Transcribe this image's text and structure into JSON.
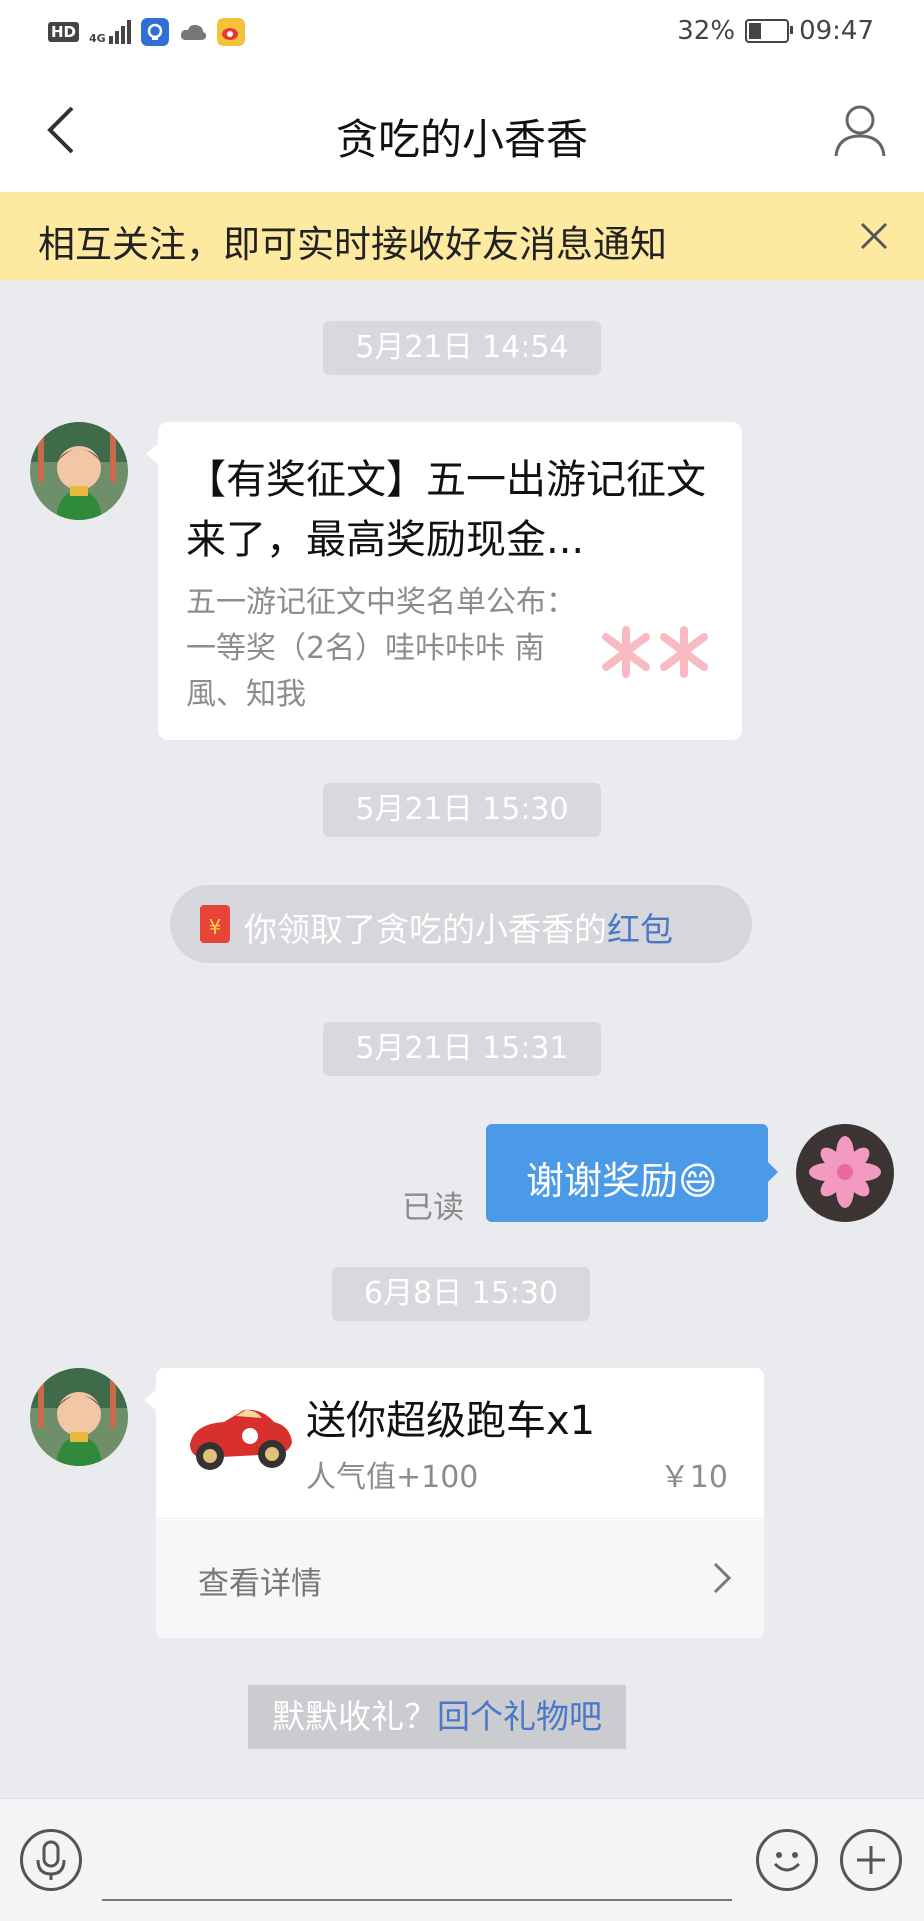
{
  "status_bar": {
    "hd": "HD",
    "network": "4G",
    "battery_percent": "32%",
    "battery_level": 0.32,
    "time": "09:47"
  },
  "header": {
    "title": "贪吃的小香香"
  },
  "notice": {
    "text": "相互关注，即可实时接收好友消息通知"
  },
  "messages": {
    "t1": "5月21日 14:54",
    "article": {
      "title": "【有奖征文】五一出游记征文来了，最高奖励现金...",
      "desc": "五一游记征文中奖名单公布：一等奖（2名）哇咔咔咔 南風、知我"
    },
    "t2": "5月21日 15:30",
    "redpacket": {
      "text": "你领取了贪吃的小香香的",
      "link": "红包",
      "icon": "¥"
    },
    "t3": "5月21日 15:31",
    "mine": {
      "text": "谢谢奖励",
      "emoji": "😄",
      "read": "已读"
    },
    "t4": "6月8日 15:30",
    "gift": {
      "title": "送你超级跑车x1",
      "popularity": "人气值+100",
      "price": "￥10",
      "detail": "查看详情"
    },
    "prompt": {
      "text": "默默收礼？",
      "link": "回个礼物吧"
    }
  },
  "colors": {
    "chat_bg": "#e9ebef",
    "notice_bg": "#fdeaa0",
    "my_bubble": "#4b9ae8",
    "link": "#4a78c9"
  }
}
